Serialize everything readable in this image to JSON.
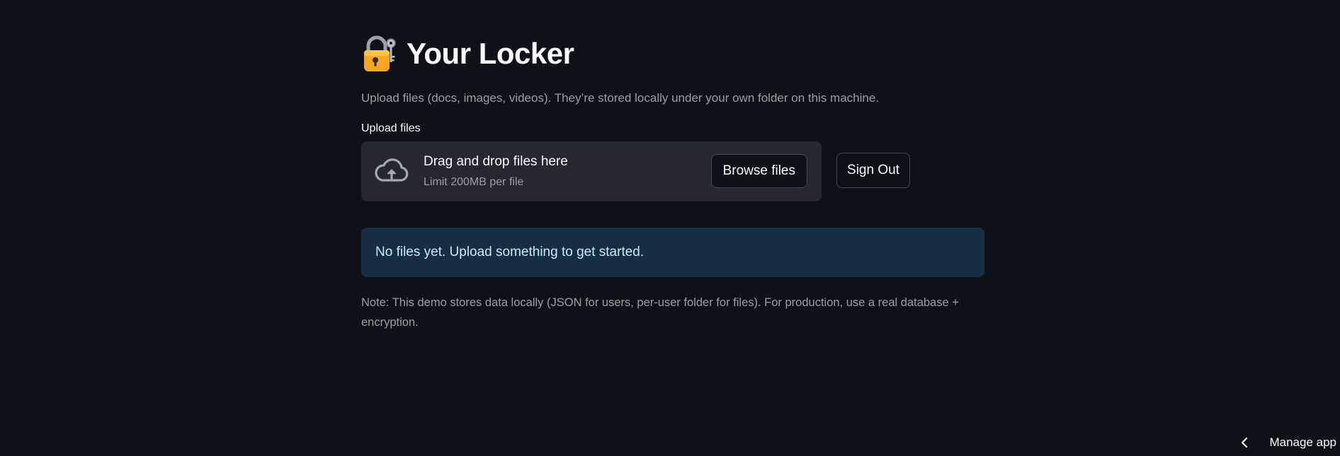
{
  "header": {
    "title": "Your Locker",
    "icon": "lock-with-key-emoji"
  },
  "caption": "Upload files (docs, images, videos). They’re stored locally under your own folder on this machine.",
  "uploader": {
    "label": "Upload files",
    "drop_text": "Drag and drop files here",
    "limit_text": "Limit 200MB per file",
    "browse_label": "Browse files",
    "icon": "cloud-upload-icon"
  },
  "sign_out_label": "Sign Out",
  "info_message": "No files yet. Upload something to get started.",
  "note": "Note: This demo stores data locally (JSON for users, per-user folder for files). For production, use a real database + encryption.",
  "footer": {
    "manage_app_label": "Manage app",
    "icon": "chevron-left-icon"
  },
  "colors": {
    "background": "#0e1117",
    "dropzone": "#262730",
    "info_bg": "#172d43",
    "info_text": "#c7ebff",
    "muted_text": "#9c9ea4"
  }
}
